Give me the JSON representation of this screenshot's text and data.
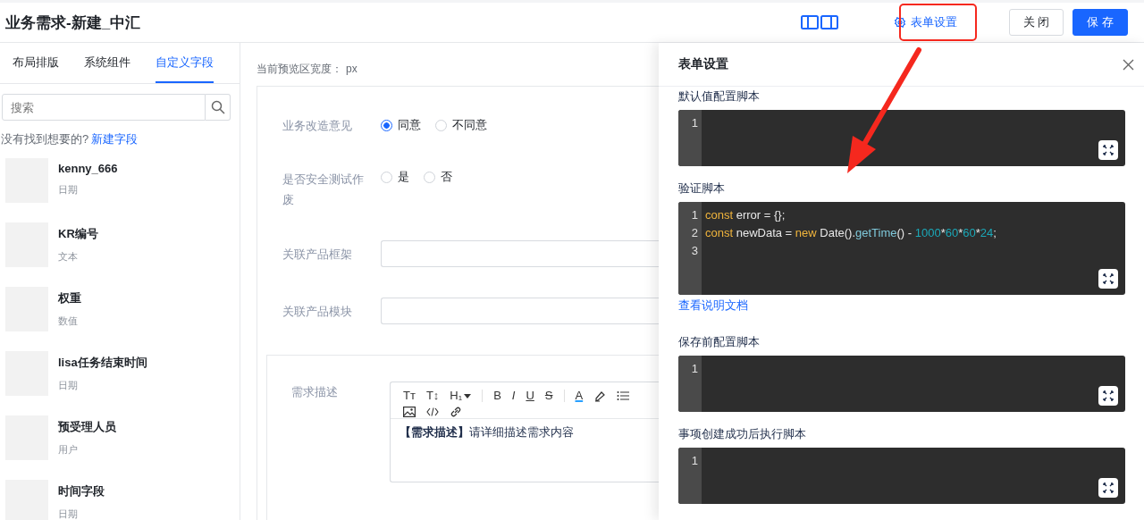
{
  "header": {
    "title": "业务需求-新建_中汇",
    "settings_button": "表单设置",
    "buttons": [
      {
        "label": "关 闭",
        "kind": "default"
      },
      {
        "label": "保 存",
        "kind": "primary"
      }
    ]
  },
  "sidebar": {
    "tabs": [
      {
        "label": "布局排版",
        "selected": false
      },
      {
        "label": "系统组件",
        "selected": false
      },
      {
        "label": "自定义字段",
        "selected": true
      }
    ],
    "search": {
      "placeholder": "搜索"
    },
    "hint": "没有找到想要的?",
    "hint_link": "新建字段",
    "items": [
      {
        "name": "kenny_666",
        "type": "日期"
      },
      {
        "name": "KR编号",
        "type": "文本"
      },
      {
        "name": "权重",
        "type": "数值"
      },
      {
        "name": "lisa任务结束时间",
        "type": "日期"
      },
      {
        "name": "预受理人员",
        "type": "用户"
      },
      {
        "name": "时间字段",
        "type": "日期"
      }
    ]
  },
  "preview": {
    "width_label": "当前预览区宽度：",
    "width_unit": "px",
    "fields": [
      {
        "kind": "radio",
        "label": "业务改造意见",
        "options": [
          {
            "label": "同意",
            "selected": true
          },
          {
            "label": "不同意",
            "selected": false
          }
        ]
      },
      {
        "kind": "radio",
        "label": "是否安全测试作废",
        "options": [
          {
            "label": "是",
            "selected": false
          },
          {
            "label": "否",
            "selected": false
          }
        ]
      },
      {
        "kind": "input",
        "label": "关联产品框架"
      },
      {
        "kind": "input",
        "label": "关联产品模块"
      }
    ],
    "editor": {
      "label": "需求描述",
      "content": "**【需求描述】**请详细描述需求内容",
      "toolbar": [
        {
          "kind": "plain",
          "glyph": "Tт"
        },
        {
          "kind": "plain",
          "glyph": "T↕"
        },
        {
          "kind": "dropdown",
          "glyph": "H₁"
        },
        {
          "kind": "separator"
        },
        {
          "kind": "bold",
          "glyph": "B"
        },
        {
          "kind": "italic",
          "glyph": "I"
        },
        {
          "kind": "underline",
          "glyph": "U"
        },
        {
          "kind": "strike",
          "glyph": "S"
        },
        {
          "kind": "separator"
        },
        {
          "kind": "color",
          "glyph": "A"
        },
        {
          "kind": "highlighter"
        },
        {
          "kind": "list"
        },
        {
          "kind": "break"
        },
        {
          "kind": "image"
        },
        {
          "kind": "code"
        },
        {
          "kind": "link"
        }
      ]
    }
  },
  "drawer": {
    "title": "表单设置",
    "scripts": [
      {
        "label": "默认值配置脚本",
        "lines": [
          {
            "number": "1"
          }
        ]
      },
      {
        "label": "验证脚本",
        "lines": [
          {
            "number": "1",
            "tokens": [
              {
                "kind": "keyword",
                "text": "const"
              },
              {
                "kind": "plain",
                "text": " error = {};"
              }
            ]
          },
          {
            "number": "2",
            "tokens": [
              {
                "kind": "keyword",
                "text": "const"
              },
              {
                "kind": "plain",
                "text": " newData = "
              },
              {
                "kind": "keyword",
                "text": "new"
              },
              {
                "kind": "plain",
                "text": " Date()."
              },
              {
                "kind": "func",
                "text": "getTime"
              },
              {
                "kind": "plain",
                "text": "() - "
              },
              {
                "kind": "number",
                "text": "1000"
              },
              {
                "kind": "plain",
                "text": "*"
              },
              {
                "kind": "number",
                "text": "60"
              },
              {
                "kind": "plain",
                "text": "*"
              },
              {
                "kind": "number",
                "text": "60"
              },
              {
                "kind": "plain",
                "text": "*"
              },
              {
                "kind": "number",
                "text": "24"
              },
              {
                "kind": "plain",
                "text": ";"
              }
            ]
          },
          {
            "number": "3"
          }
        ],
        "link": "查看说明文档"
      },
      {
        "label": "保存前配置脚本",
        "lines": [
          {
            "number": "1"
          }
        ]
      },
      {
        "label": "事项创建成功后执行脚本",
        "lines": [
          {
            "number": "1"
          }
        ]
      }
    ]
  }
}
